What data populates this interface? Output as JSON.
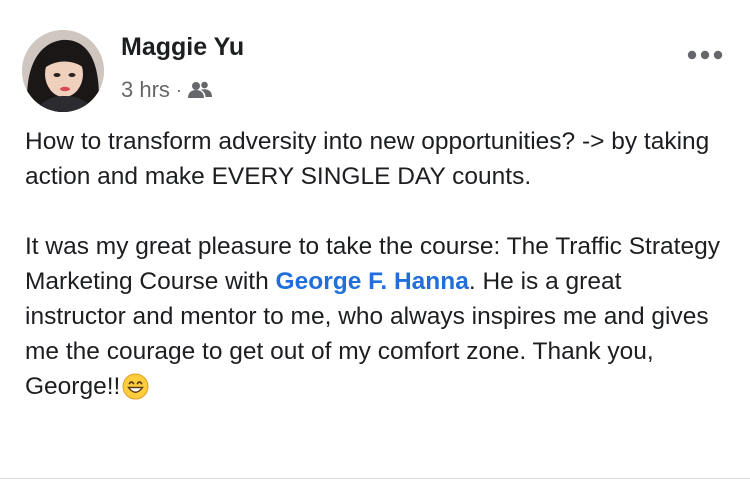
{
  "post": {
    "author": "Maggie Yu",
    "timestamp": "3 hrs",
    "separator": "·",
    "audience_icon": "friends-icon",
    "more_icon": "more-options-icon",
    "paragraph1": "How to transform adversity into new opportunities? -> by taking action and make EVERY SINGLE DAY counts.",
    "paragraph2_before": "It was my great pleasure to take the course: The Traffic Strategy Marketing Course with ",
    "mention": "George F. Hanna",
    "paragraph2_after": ". He is a great instructor and mentor to me, who always inspires me and gives me the courage to get out of my comfort zone. Thank you, George!!",
    "emoji": "grinning-face-icon",
    "colors": {
      "text": "#1c1e21",
      "secondary": "#65676b",
      "link": "#216fdb"
    }
  }
}
